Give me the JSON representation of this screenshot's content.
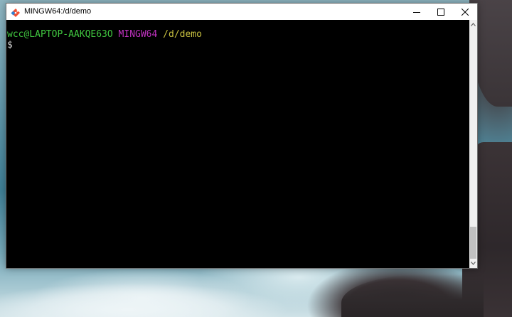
{
  "window": {
    "title": "MINGW64:/d/demo"
  },
  "terminal": {
    "prompt": {
      "user_host": "wcc@LAPTOP-AAKQE63O",
      "msystem": "MINGW64",
      "cwd": "/d/demo"
    },
    "input_prefix": "$",
    "colors": {
      "user_host": "#41c840",
      "msystem": "#c233c2",
      "cwd": "#c8c040",
      "background": "#000000"
    }
  },
  "icons": {
    "app": "git-bash-icon",
    "minimize": "minimize-icon",
    "maximize": "maximize-icon",
    "close": "close-icon",
    "scroll_up": "chevron-up-icon",
    "scroll_down": "chevron-down-icon"
  }
}
